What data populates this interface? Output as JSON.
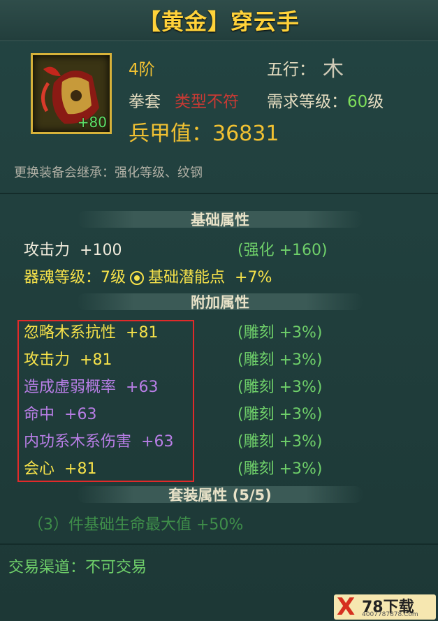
{
  "title": "【黄金】穿云手",
  "item": {
    "enhance": "+80",
    "tier": "4阶",
    "element_label": "五行：",
    "element_value": "木",
    "type": "拳套",
    "type_warning": "类型不符",
    "req_label": "需求等级：",
    "req_level": "60",
    "req_unit": "级",
    "armor_label": "兵甲值：",
    "armor_value": "36831",
    "inherit_note": "更换装备会继承：强化等级、纹钢"
  },
  "basic": {
    "header": "基础属性",
    "attack_label": "攻击力",
    "attack_value": "+100",
    "attack_bonus": "(强化 +160)",
    "soul_label": "器魂等级：7级",
    "potential": "基础潜能点",
    "potential_value": "+7%"
  },
  "extra": {
    "header": "附加属性",
    "rows": [
      {
        "label": "忽略木系抗性",
        "value": "+81",
        "bonus": "(雕刻 +3%)"
      },
      {
        "label": "攻击力",
        "value": "+81",
        "bonus": "(雕刻 +3%)"
      },
      {
        "label": "造成虚弱概率",
        "value": "+63",
        "bonus": "(雕刻 +3%)"
      },
      {
        "label": "命中",
        "value": "+63",
        "bonus": "(雕刻 +3%)"
      },
      {
        "label": "内功系木系伤害",
        "value": "+63",
        "bonus": "(雕刻 +3%)"
      },
      {
        "label": "会心",
        "value": "+81",
        "bonus": "(雕刻 +3%)"
      }
    ]
  },
  "set": {
    "header": "套装属性 (5/5)",
    "bonus": "（3）件基础生命最大值  +50%"
  },
  "trade": "交易渠道：不可交易",
  "watermark": {
    "mark": "X",
    "name": "78下载",
    "site": "4007787878.Com"
  }
}
